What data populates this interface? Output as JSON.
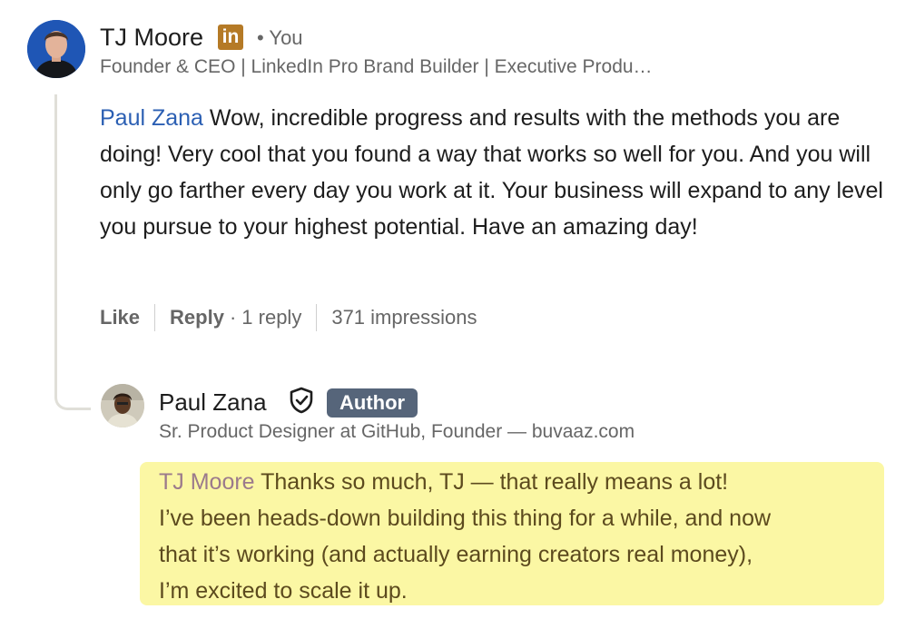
{
  "post": {
    "author": {
      "name": "TJ Moore",
      "badge_text": "in",
      "badge_icon": "linkedin-icon",
      "separator": "•",
      "relation": "You",
      "headline": "Founder & CEO | LinkedIn Pro Brand Builder | Executive Produ…"
    },
    "comment": {
      "mention": "Paul Zana",
      "text": "Wow, incredible progress and results with the methods you are doing! Very cool that you found a way that works so well for you. And you will only go farther every day you work at it. Your business will expand to any level you pursue to your highest potential. Have an amazing day!"
    },
    "actions": {
      "like": "Like",
      "reply": "Reply",
      "dot": "·",
      "reply_count": "1 reply",
      "impressions": "371 impressions"
    }
  },
  "reply": {
    "author": {
      "name": "Paul Zana",
      "verified_icon": "shield-check-icon",
      "badge": "Author",
      "headline": "Sr. Product Designer at GitHub, Founder — buvaaz.com"
    },
    "mention": "TJ Moore",
    "lines": [
      "Thanks so much, TJ — that really means a lot!",
      "I’ve been heads-down building this thing for a while, and now",
      "that it’s working (and actually earning creators real money),",
      "I’m excited to scale it up."
    ]
  },
  "colors": {
    "mention": "#2b5fb3",
    "linkedin_badge": "#b57a26",
    "author_badge": "#56657a",
    "highlight": "#fbf7a4",
    "reply_text": "#5c4a1e"
  }
}
